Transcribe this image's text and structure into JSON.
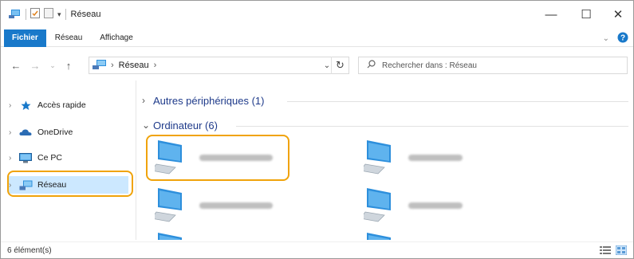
{
  "window": {
    "title": "Réseau",
    "controls": {
      "minimize": "—",
      "maximize": "☐",
      "close": "✕"
    }
  },
  "ribbon": {
    "tabs": [
      {
        "label": "Fichier",
        "active": true
      },
      {
        "label": "Réseau",
        "active": false
      },
      {
        "label": "Affichage",
        "active": false
      }
    ]
  },
  "address": {
    "breadcrumb": [
      "Réseau"
    ],
    "search_placeholder": "Rechercher dans : Réseau"
  },
  "nav": {
    "items": [
      {
        "label": "Accès rapide",
        "icon": "star-icon"
      },
      {
        "label": "OneDrive",
        "icon": "cloud-icon"
      },
      {
        "label": "Ce PC",
        "icon": "monitor-icon"
      },
      {
        "label": "Réseau",
        "icon": "network-icon",
        "selected": true
      }
    ]
  },
  "content": {
    "groups": [
      {
        "label": "Autres périphériques (1)",
        "expanded": false
      },
      {
        "label": "Ordinateur (6)",
        "expanded": true
      }
    ],
    "computer_names_blurred": true
  },
  "status": {
    "item_count": "6 élément(s)"
  },
  "colors": {
    "accent": "#1979ca",
    "highlight_ring": "#f0a30a",
    "selection": "#cce8ff"
  }
}
